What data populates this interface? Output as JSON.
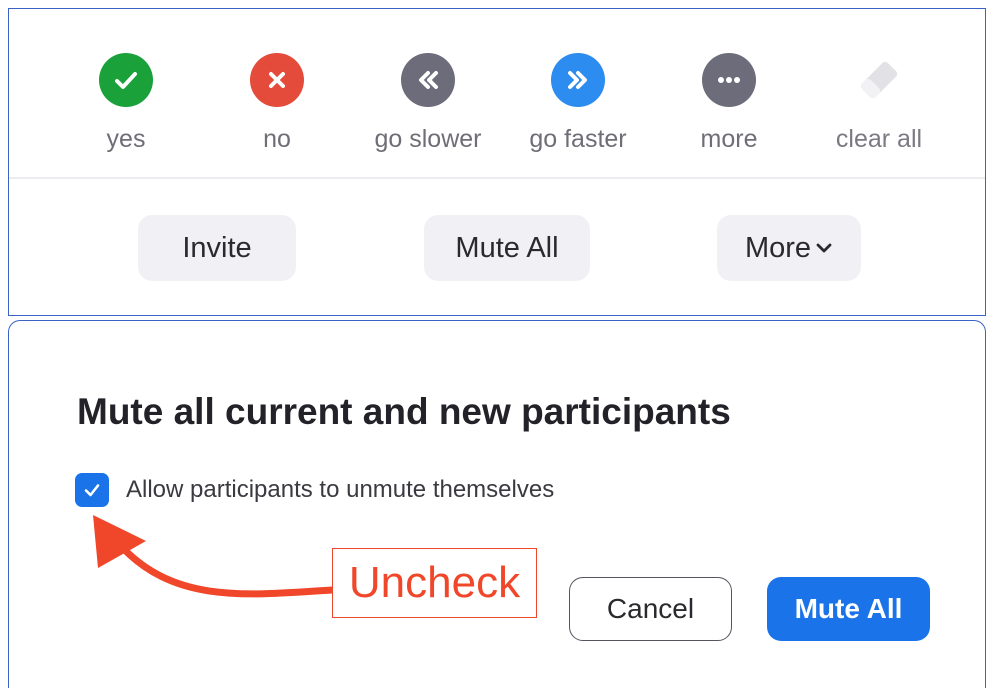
{
  "reactions": [
    {
      "label": "yes",
      "icon": "check-icon",
      "color": "#1aa13a"
    },
    {
      "label": "no",
      "icon": "x-icon",
      "color": "#e44b3b"
    },
    {
      "label": "go slower",
      "icon": "double-chevron-left-icon",
      "color": "#6c6c7a"
    },
    {
      "label": "go faster",
      "icon": "double-chevron-right-icon",
      "color": "#2d8cf0"
    },
    {
      "label": "more",
      "icon": "ellipsis-icon",
      "color": "#6c6c7a"
    },
    {
      "label": "clear all",
      "icon": "eraser-icon",
      "color": "#dcdce0"
    }
  ],
  "participant_actions": {
    "invite": "Invite",
    "mute_all": "Mute All",
    "more": "More"
  },
  "dialog": {
    "title": "Mute all current and new participants",
    "checkbox_label": "Allow participants to unmute themselves",
    "checkbox_checked": true,
    "cancel": "Cancel",
    "confirm": "Mute All"
  },
  "annotation": {
    "text": "Uncheck",
    "color": "#f0472a"
  }
}
